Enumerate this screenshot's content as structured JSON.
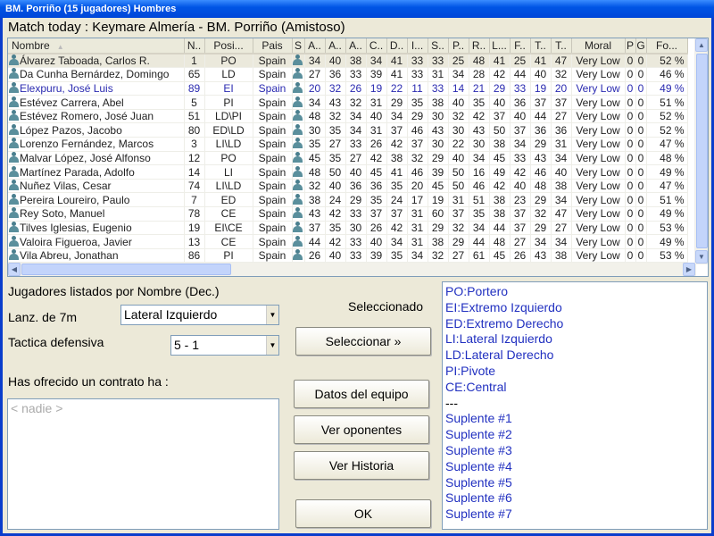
{
  "window_title": "BM. Porriño (15 jugadores) Hombres",
  "match_title": "Match today : Keymare Almería - BM. Porriño (Amistoso)",
  "table": {
    "columns": [
      "Nombre",
      "N..",
      "Posi...",
      "Pais",
      "S",
      "A..",
      "A..",
      "A..",
      "C..",
      "D..",
      "I...",
      "S..",
      "P..",
      "R..",
      "L...",
      "F..",
      "T..",
      "T..",
      "Moral",
      "P",
      "G",
      "Fo..."
    ],
    "sort_indicator": "▲",
    "rows": [
      {
        "name": "Álvarez Taboada, Carlos R.",
        "n": "1",
        "pos": "PO",
        "pais": "Spain",
        "stats": [
          "34",
          "40",
          "38",
          "34",
          "41",
          "33",
          "33",
          "25",
          "48",
          "41",
          "25",
          "41",
          "47"
        ],
        "moral": "Very Low",
        "p": "0",
        "g": "0",
        "fo": "52 %",
        "selected": true
      },
      {
        "name": "Da Cunha Bernárdez, Domingo",
        "n": "65",
        "pos": "LD",
        "pais": "Spain",
        "stats": [
          "27",
          "36",
          "33",
          "39",
          "41",
          "33",
          "31",
          "34",
          "28",
          "42",
          "44",
          "40",
          "32"
        ],
        "moral": "Very Low",
        "p": "0",
        "g": "0",
        "fo": "46 %"
      },
      {
        "name": "Elexpuru, José Luis",
        "n": "89",
        "pos": "EI",
        "pais": "Spain",
        "stats": [
          "20",
          "32",
          "26",
          "19",
          "22",
          "11",
          "33",
          "14",
          "21",
          "29",
          "33",
          "19",
          "20"
        ],
        "moral": "Very Low",
        "p": "0",
        "g": "0",
        "fo": "49 %",
        "highlight": true
      },
      {
        "name": "Estévez Carrera, Abel",
        "n": "5",
        "pos": "PI",
        "pais": "Spain",
        "stats": [
          "34",
          "43",
          "32",
          "31",
          "29",
          "35",
          "38",
          "40",
          "35",
          "40",
          "36",
          "37",
          "37"
        ],
        "moral": "Very Low",
        "p": "0",
        "g": "0",
        "fo": "51 %"
      },
      {
        "name": "Estévez Romero, José Juan",
        "n": "51",
        "pos": "LD\\PI",
        "pais": "Spain",
        "stats": [
          "48",
          "32",
          "34",
          "40",
          "34",
          "29",
          "30",
          "32",
          "42",
          "37",
          "40",
          "44",
          "27"
        ],
        "moral": "Very Low",
        "p": "0",
        "g": "0",
        "fo": "52 %"
      },
      {
        "name": "López Pazos, Jacobo",
        "n": "80",
        "pos": "ED\\LD",
        "pais": "Spain",
        "stats": [
          "30",
          "35",
          "34",
          "31",
          "37",
          "46",
          "43",
          "30",
          "43",
          "50",
          "37",
          "36",
          "36"
        ],
        "moral": "Very Low",
        "p": "0",
        "g": "0",
        "fo": "52 %"
      },
      {
        "name": "Lorenzo Fernández, Marcos",
        "n": "3",
        "pos": "LI\\LD",
        "pais": "Spain",
        "stats": [
          "35",
          "27",
          "33",
          "26",
          "42",
          "37",
          "30",
          "22",
          "30",
          "38",
          "34",
          "29",
          "31"
        ],
        "moral": "Very Low",
        "p": "0",
        "g": "0",
        "fo": "47 %"
      },
      {
        "name": "Malvar López, José Alfonso",
        "n": "12",
        "pos": "PO",
        "pais": "Spain",
        "stats": [
          "45",
          "35",
          "27",
          "42",
          "38",
          "32",
          "29",
          "40",
          "34",
          "45",
          "33",
          "43",
          "34"
        ],
        "moral": "Very Low",
        "p": "0",
        "g": "0",
        "fo": "48 %"
      },
      {
        "name": "Martínez Parada, Adolfo",
        "n": "14",
        "pos": "LI",
        "pais": "Spain",
        "stats": [
          "48",
          "50",
          "40",
          "45",
          "41",
          "46",
          "39",
          "50",
          "16",
          "49",
          "42",
          "46",
          "40"
        ],
        "moral": "Very Low",
        "p": "0",
        "g": "0",
        "fo": "49 %"
      },
      {
        "name": "Nuñez Vilas, Cesar",
        "n": "74",
        "pos": "LI\\LD",
        "pais": "Spain",
        "stats": [
          "32",
          "40",
          "36",
          "36",
          "35",
          "20",
          "45",
          "50",
          "46",
          "42",
          "40",
          "48",
          "38"
        ],
        "moral": "Very Low",
        "p": "0",
        "g": "0",
        "fo": "47 %"
      },
      {
        "name": "Pereira Loureiro, Paulo",
        "n": "7",
        "pos": "ED",
        "pais": "Spain",
        "stats": [
          "38",
          "24",
          "29",
          "35",
          "24",
          "17",
          "19",
          "31",
          "51",
          "38",
          "23",
          "29",
          "34"
        ],
        "moral": "Very Low",
        "p": "0",
        "g": "0",
        "fo": "51 %"
      },
      {
        "name": "Rey Soto, Manuel",
        "n": "78",
        "pos": "CE",
        "pais": "Spain",
        "stats": [
          "43",
          "42",
          "33",
          "37",
          "37",
          "31",
          "60",
          "37",
          "35",
          "38",
          "37",
          "32",
          "47"
        ],
        "moral": "Very Low",
        "p": "0",
        "g": "0",
        "fo": "49 %"
      },
      {
        "name": "Tilves Iglesias, Eugenio",
        "n": "19",
        "pos": "EI\\CE",
        "pais": "Spain",
        "stats": [
          "37",
          "35",
          "30",
          "26",
          "42",
          "31",
          "29",
          "32",
          "34",
          "44",
          "37",
          "29",
          "27"
        ],
        "moral": "Very Low",
        "p": "0",
        "g": "0",
        "fo": "53 %"
      },
      {
        "name": "Valoira Figueroa, Javier",
        "n": "13",
        "pos": "CE",
        "pais": "Spain",
        "stats": [
          "44",
          "42",
          "33",
          "40",
          "34",
          "31",
          "38",
          "29",
          "44",
          "48",
          "27",
          "34",
          "34"
        ],
        "moral": "Very Low",
        "p": "0",
        "g": "0",
        "fo": "49 %"
      },
      {
        "name": "Vila Abreu, Jonathan",
        "n": "86",
        "pos": "PI",
        "pais": "Spain",
        "stats": [
          "26",
          "40",
          "33",
          "39",
          "35",
          "34",
          "32",
          "27",
          "61",
          "45",
          "26",
          "43",
          "38"
        ],
        "moral": "Very Low",
        "p": "0",
        "g": "0",
        "fo": "53 %"
      }
    ]
  },
  "controls": {
    "sorted_by": "Jugadores listados por Nombre (Dec.)",
    "lanz_label": "Lanz. de 7m",
    "lanz_value": "Lateral Izquierdo",
    "tactica_label": "Tactica defensiva",
    "tactica_value": "5 - 1",
    "contrato_label": "Has ofrecido un contrato ha :",
    "contrato_empty": "< nadie >",
    "seleccionado_label": "Seleccionado",
    "seleccionar_button": "Seleccionar »",
    "datos_button": "Datos del equipo",
    "oponentes_button": "Ver oponentes",
    "historia_button": "Ver Historia",
    "ok_button": "OK"
  },
  "positions": [
    "PO:Portero",
    "EI:Extremo Izquierdo",
    "ED:Extremo Derecho",
    "LI:Lateral Izquierdo",
    "LD:Lateral Derecho",
    "PI:Pivote",
    "CE:Central",
    "---",
    "Suplente #1",
    "Suplente #2",
    "Suplente #3",
    "Suplente #4",
    "Suplente #5",
    "Suplente #6",
    "Suplente #7"
  ],
  "colors": {
    "titlebar": "#0055e5",
    "highlight_text": "#2a2ab0",
    "position_list_text": "#2130c0",
    "selected_row": "#ebe9dc"
  }
}
